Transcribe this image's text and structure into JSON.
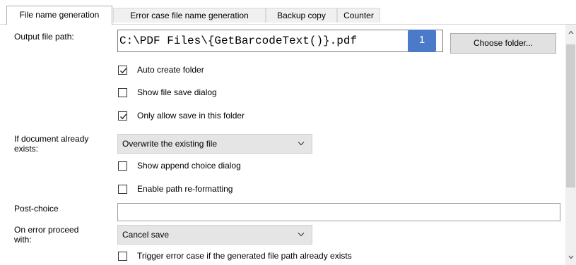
{
  "tabs": [
    {
      "label": "File name generation",
      "active": true
    },
    {
      "label": "Error case file name generation",
      "active": false
    },
    {
      "label": "Backup copy",
      "active": false
    },
    {
      "label": "Counter",
      "active": false
    }
  ],
  "output_path": {
    "label": "Output file path:",
    "value": "C:\\PDF Files\\{GetBarcodeText()}.pdf",
    "badge": "1",
    "choose_folder_label": "Choose folder..."
  },
  "options": {
    "auto_create_folder": {
      "label": "Auto create folder",
      "checked": true
    },
    "show_file_save_dialog": {
      "label": "Show file save dialog",
      "checked": false
    },
    "only_allow_save": {
      "label": "Only allow save in this folder",
      "checked": true
    }
  },
  "document_exists": {
    "label_line1": "If document already",
    "label_line2": "exists:",
    "selected": "Overwrite the existing file",
    "show_append_choice": {
      "label": "Show append choice dialog",
      "checked": false
    },
    "enable_path_reformatting": {
      "label": "Enable path re-formatting",
      "checked": false
    }
  },
  "post_choice": {
    "label": "Post-choice",
    "value": ""
  },
  "on_error": {
    "label_line1": "On error proceed",
    "label_line2": "with:",
    "selected": "Cancel save",
    "trigger_error_case": {
      "label": "Trigger error case if the generated file path already exists",
      "checked": false
    }
  },
  "colors": {
    "badge": "#4a7ac8",
    "combo_bg": "#e5e5e5",
    "button_bg": "#e1e1e1"
  }
}
